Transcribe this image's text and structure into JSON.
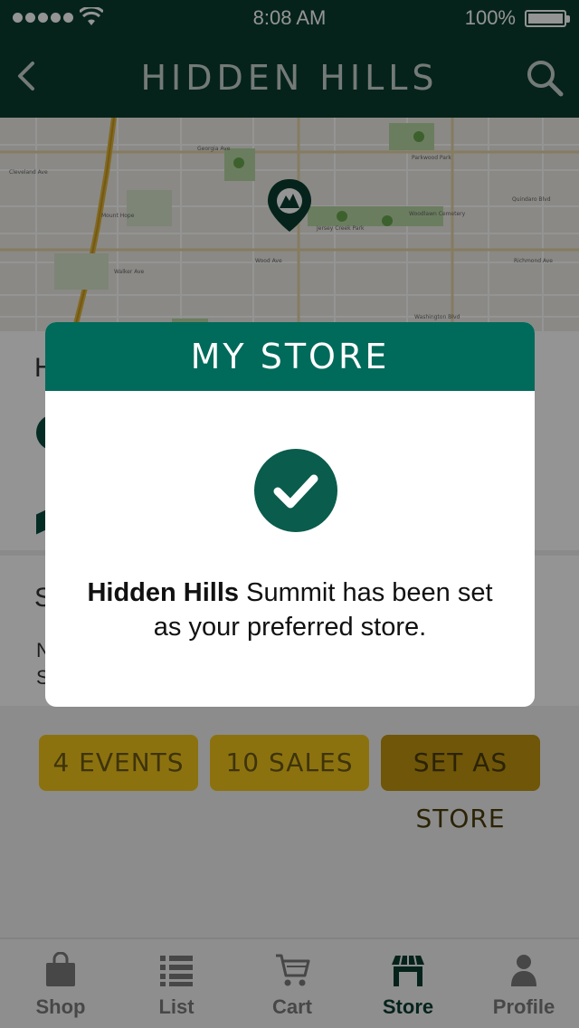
{
  "status_bar": {
    "time": "8:08 AM",
    "battery": "100%"
  },
  "nav": {
    "title": "HIDDEN HILLS"
  },
  "map": {
    "labels": [
      "Georgia Ave",
      "Cleveland Ave",
      "Walker Ave",
      "Wood Ave",
      "Jersey Creek Park",
      "Parkwood Park",
      "Washington Blvd",
      "Richmond Ave",
      "Quindaro Blvd",
      "Woodlawn Cemetery",
      "Heathwood Park",
      "Mount Hope Cemetery"
    ],
    "pin_icon": "store-pin-icon"
  },
  "content": {
    "heading_1": "H",
    "heading_2": "S",
    "line_1": "N",
    "line_2": "S"
  },
  "actions": {
    "events": "4 EVENTS",
    "sales": "10 SALES",
    "set_store": "SET AS STORE"
  },
  "modal": {
    "title": "MY STORE",
    "store_name": "Hidden Hills",
    "message_rest": " Summit has been set as your preferred store."
  },
  "tabs": [
    {
      "label": "Shop",
      "icon": "bag-icon",
      "active": false
    },
    {
      "label": "List",
      "icon": "list-icon",
      "active": false
    },
    {
      "label": "Cart",
      "icon": "cart-icon",
      "active": false
    },
    {
      "label": "Store",
      "icon": "store-icon",
      "active": true
    },
    {
      "label": "Profile",
      "icon": "person-icon",
      "active": false
    }
  ],
  "colors": {
    "header": "#0a3d30",
    "modal_header": "#006a5b",
    "accent": "#f2c41a",
    "check": "#0a5c4c"
  }
}
